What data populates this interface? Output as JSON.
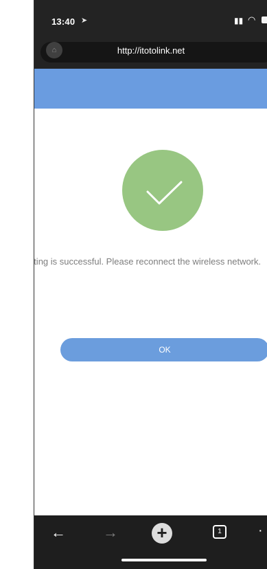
{
  "status_bar": {
    "time": "13:40"
  },
  "browser": {
    "url": "http://itotolink.net"
  },
  "page": {
    "message": "The setting is successful. Please reconnect the wireless network.",
    "ok_label": "OK"
  },
  "colors": {
    "header_blue": "#6a9ce0",
    "success_green": "#98c682",
    "button_blue": "#6b9ddd"
  },
  "toolbar": {
    "tab_count": "1"
  }
}
